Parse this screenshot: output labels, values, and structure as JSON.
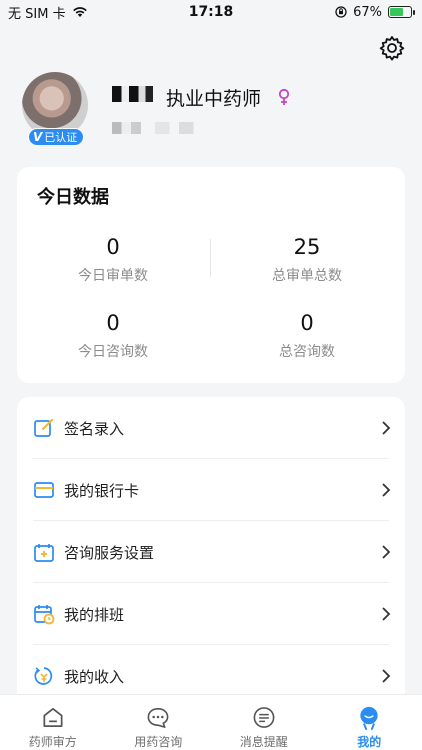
{
  "status_bar": {
    "carrier": "无 SIM 卡",
    "time": "17:18",
    "battery": "67%",
    "battery_level": 0.67
  },
  "profile": {
    "verified_label": "已认证",
    "title": "执业中药师"
  },
  "today_data": {
    "title": "今日数据",
    "stats": [
      {
        "value": "0",
        "label": "今日审单数"
      },
      {
        "value": "25",
        "label": "总审单总数"
      },
      {
        "value": "0",
        "label": "今日咨询数"
      },
      {
        "value": "0",
        "label": "总咨询数"
      }
    ]
  },
  "menu": {
    "items": [
      {
        "label": "签名录入",
        "icon": "edit-icon"
      },
      {
        "label": "我的银行卡",
        "icon": "card-icon"
      },
      {
        "label": "咨询服务设置",
        "icon": "calendar-add-icon"
      },
      {
        "label": "我的排班",
        "icon": "schedule-icon"
      },
      {
        "label": "我的收入",
        "icon": "income-icon"
      }
    ]
  },
  "tabs": [
    {
      "label": "药师审方",
      "icon": "home-icon"
    },
    {
      "label": "用药咨询",
      "icon": "chat-icon"
    },
    {
      "label": "消息提醒",
      "icon": "message-icon"
    },
    {
      "label": "我的",
      "icon": "profile-icon",
      "active": true
    }
  ],
  "colors": {
    "accent": "#2b8cf2",
    "icon_yellow": "#f2b733",
    "background": "#f4f5f7",
    "female": "#c545c2"
  }
}
